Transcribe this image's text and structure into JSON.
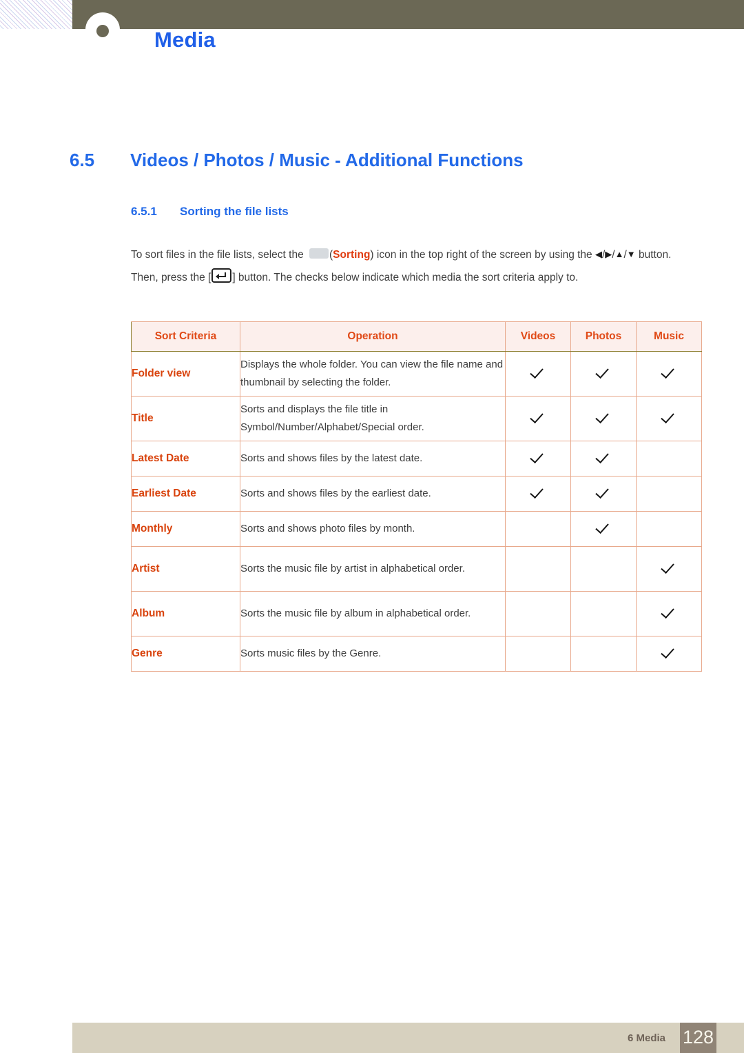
{
  "header": {
    "chapter_title": "Media",
    "badge_icon": "chapter-circle-icon",
    "band_color": "#6b6855",
    "title_color": "#1F5FE8"
  },
  "headings": {
    "section_number": "6.5",
    "section_title": "Videos / Photos / Music - Additional Functions",
    "subsection_number": "6.5.1",
    "subsection_title": "Sorting the file lists"
  },
  "paragraph": {
    "part1": "To sort files in the file lists, select the ",
    "sorting_icon": "sorting-icon",
    "paren_open": "(",
    "sorting_word": "Sorting",
    "part2": ") icon in the top right of the screen by using the ",
    "arrow_left": "◀",
    "slash1": "/",
    "arrow_right": "▶",
    "slash2": "/",
    "arrow_up": "▲",
    "slash3": "/",
    "arrow_down": "▼",
    "part3": " button. Then, press the [",
    "enter_key": "enter-key-icon",
    "part4": "] button. The checks below indicate which media the sort criteria apply to."
  },
  "table": {
    "headers": [
      "Sort Criteria",
      "Operation",
      "Videos",
      "Photos",
      "Music"
    ],
    "rows": [
      {
        "criteria": "Folder view",
        "operation": "Displays the whole folder. You can view the file name and thumbnail by selecting the folder.",
        "videos": true,
        "photos": true,
        "music": true,
        "height": "tall"
      },
      {
        "criteria": "Title",
        "operation": "Sorts and displays the file title in Symbol/Number/Alphabet/Special order.",
        "videos": true,
        "photos": true,
        "music": true,
        "height": "tall"
      },
      {
        "criteria": "Latest Date",
        "operation": "Sorts and shows files by the latest date.",
        "videos": true,
        "photos": true,
        "music": false,
        "height": "short"
      },
      {
        "criteria": "Earliest Date",
        "operation": "Sorts and shows files by the earliest date.",
        "videos": true,
        "photos": true,
        "music": false,
        "height": "short"
      },
      {
        "criteria": "Monthly",
        "operation": "Sorts and shows photo files by month.",
        "videos": false,
        "photos": true,
        "music": false,
        "height": "short"
      },
      {
        "criteria": "Artist",
        "operation": "Sorts the music file by artist in alphabetical order.",
        "videos": false,
        "photos": false,
        "music": true,
        "height": "tall"
      },
      {
        "criteria": "Album",
        "operation": "Sorts the music file by album in alphabetical order.",
        "videos": false,
        "photos": false,
        "music": true,
        "height": "tall"
      },
      {
        "criteria": "Genre",
        "operation": "Sorts music files by the Genre.",
        "videos": false,
        "photos": false,
        "music": true,
        "height": "short"
      }
    ],
    "header_bg": "#FCEFEC",
    "header_text_color": "#E04A17",
    "criteria_text_color": "#D9430D",
    "outer_border_color": "#8a7b2a",
    "inner_border_color": "#E8A98C",
    "check_symbol": "checkmark-icon"
  },
  "footer": {
    "chapter_label": "6 Media",
    "page_number": "128",
    "band_color": "#D7D1BF",
    "page_box_color": "#908476"
  }
}
